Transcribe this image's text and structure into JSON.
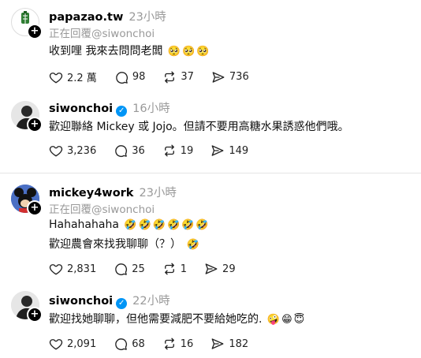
{
  "posts": [
    {
      "username": "papazao.tw",
      "time": "23小時",
      "reply_to": "正在回覆@siwonchoi",
      "text": "收到哩 我來去問問老闆",
      "emojis": [
        "🥺",
        "🥺",
        "🥺"
      ],
      "likes": "2.2 萬",
      "comments": "98",
      "reposts": "37",
      "shares": "736",
      "avatar_label": "農糖廠",
      "verified": false
    },
    {
      "username": "siwonchoi",
      "time": "16小時",
      "reply_to": "",
      "text": "歡迎聯絡 Mickey 或 Jojo。但請不要用高糖水果誘惑他們哦。",
      "emojis": [],
      "likes": "3,236",
      "comments": "36",
      "reposts": "19",
      "shares": "149",
      "verified": true
    },
    {
      "username": "mickey4work",
      "time": "23小時",
      "reply_to": "正在回覆@siwonchoi",
      "text": "Hahahahaha",
      "emojis": [
        "🤣",
        "🤣",
        "🤣",
        "🤣",
        "🤣",
        "🤣"
      ],
      "text2": "歡迎農會來找我聊聊（？）",
      "emojis2": [
        "🤣"
      ],
      "likes": "2,831",
      "comments": "25",
      "reposts": "1",
      "shares": "29",
      "verified": false
    },
    {
      "username": "siwonchoi",
      "time": "22小時",
      "reply_to": "",
      "text": "歡迎找她聊聊，但他需要減肥不要給她吃的.",
      "emojis": [
        "🤪",
        "😁",
        "😇"
      ],
      "likes": "2,091",
      "comments": "68",
      "reposts": "16",
      "shares": "182",
      "verified": true
    }
  ],
  "icons": {
    "like": "heart-icon",
    "comment": "comment-icon",
    "repost": "repost-icon",
    "share": "share-icon",
    "follow": "plus-icon",
    "verified": "verified-badge-icon"
  },
  "colors": {
    "verified": "#0095f6",
    "muted": "#999999",
    "divider": "#e5e5e5"
  }
}
